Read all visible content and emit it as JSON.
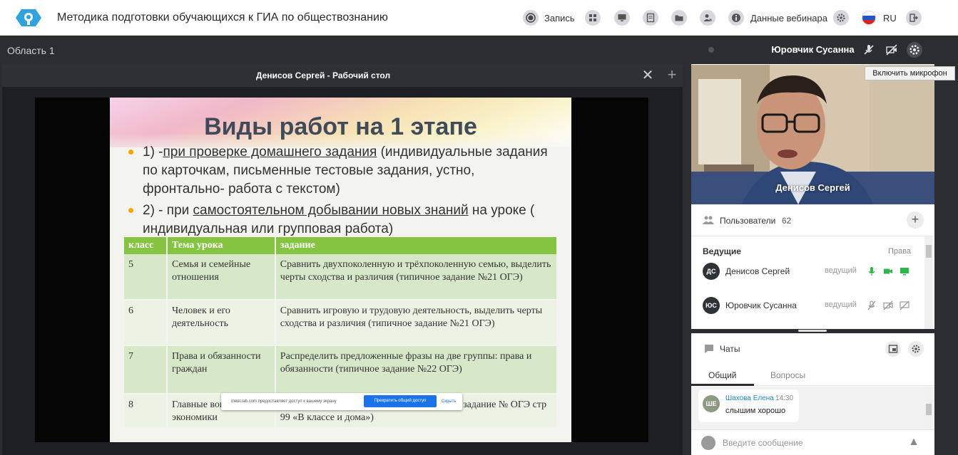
{
  "app": {
    "title": "Методика подготовки обучающихся к ГИА по обществознанию"
  },
  "toolbar": {
    "record_label": "Запись",
    "webinar_data_label": "Данные вебинара",
    "lang_label": "RU"
  },
  "area": {
    "label": "Область 1"
  },
  "share": {
    "title": "Денисов Сергей - Рабочий стол",
    "bar_text": "meet.lab.com предоставляет доступ к вашему экрану",
    "stop_label": "Прекратить общий доступ",
    "hide_label": "Скрыть"
  },
  "slide": {
    "title": "Виды работ на 1 этапе",
    "bullet1_pre": "1) -",
    "bullet1_u": "при проверке домашнего задания",
    "bullet1_post": " (индивидуальные задания по карточкам, письменные тестовые задания, устно, фронтально- работа с текстом)",
    "bullet2_pre": "2) - при ",
    "bullet2_u": "самостоятельном добывании новых знаний",
    "bullet2_post": "  на уроке ( индивидуальная или групповая работа)",
    "table": {
      "headers": [
        "класс",
        "Тема урока",
        "задание"
      ],
      "rows": [
        [
          "5",
          "Семья и семейные отношения",
          "Сравнить двухпоколенную и трёхпоколенную семью, выделить черты сходства и различия (типичное задание  №21 ОГЭ)"
        ],
        [
          "6",
          "Человек и его деятельность",
          "Сравнить игровую и трудовую деятельность, выделить черты сходства и различия (типичное задание  №21 ОГЭ)"
        ],
        [
          "7",
          "Права и обязанности граждан",
          "Распределить предложенные фразы на две группы: права и обязанности (типичное задание  №22 ОГЭ)"
        ],
        [
          "8",
          "Главные вопросы экономики",
          "Решение экономической задачи (типичное задание  №    ОГЭ стр 99 «В классе и дома»)"
        ]
      ]
    }
  },
  "video": {
    "header_name": "Юровчик Сусанна",
    "tooltip": "Включить микрофон",
    "label": "Денисов Сергей"
  },
  "users": {
    "title": "Пользователи",
    "count": "62",
    "section": "Ведущие",
    "rights": "Права",
    "list": [
      {
        "initials": "ДС",
        "name": "Денисов Сергей",
        "role": "ведущий"
      },
      {
        "initials": "ЮС",
        "name": "Юровчик Сусанна",
        "role": "ведущий"
      }
    ]
  },
  "chat": {
    "title": "Чаты",
    "tabs": [
      "Общий",
      "Вопросы"
    ],
    "messages": [
      {
        "initials": "ШЕ",
        "author": "Шахова Елена",
        "time": "14:30",
        "text": "слышим хорошо"
      }
    ],
    "placeholder": "Введите сообщение"
  },
  "colors": {
    "accent": "#2b2d31",
    "green": "#85c441",
    "link": "#1e88c8"
  }
}
